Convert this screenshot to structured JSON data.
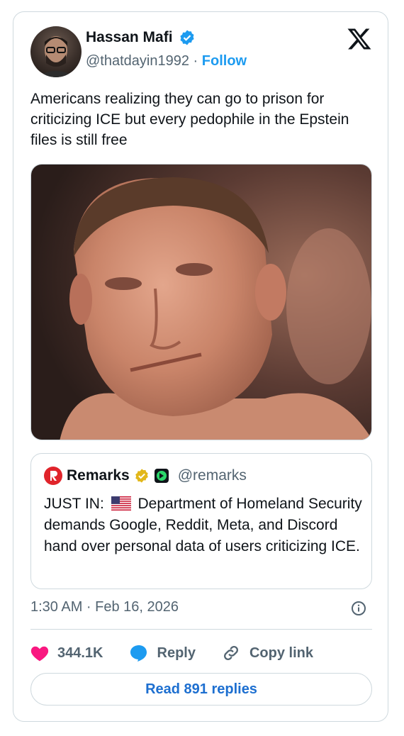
{
  "author": {
    "name": "Hassan Mafi",
    "handle": "@thatdayin1992",
    "separator": "·",
    "follow_label": "Follow"
  },
  "tweet": {
    "text": "Americans realizing they can go to prison for criticizing ICE but every pedophile in the Epstein files is still free"
  },
  "quote": {
    "name": "Remarks",
    "handle": "@remarks",
    "prefix": "JUST IN:",
    "text": "Department of Homeland Security demands Google, Reddit, Meta, and Discord hand over personal data of users criticizing ICE."
  },
  "meta": {
    "timestamp": "1:30 AM · Feb 16, 2026"
  },
  "actions": {
    "likes": "344.1K",
    "reply_label": "Reply",
    "copy_label": "Copy link"
  },
  "footer": {
    "read_replies": "Read 891 replies"
  },
  "colors": {
    "accent": "#1d9bf0",
    "like": "#f91880",
    "border": "#cfd9de"
  },
  "icons": [
    "x-logo-icon",
    "verified-badge-icon",
    "heart-icon",
    "reply-bubble-icon",
    "link-icon",
    "info-icon",
    "us-flag-icon"
  ]
}
